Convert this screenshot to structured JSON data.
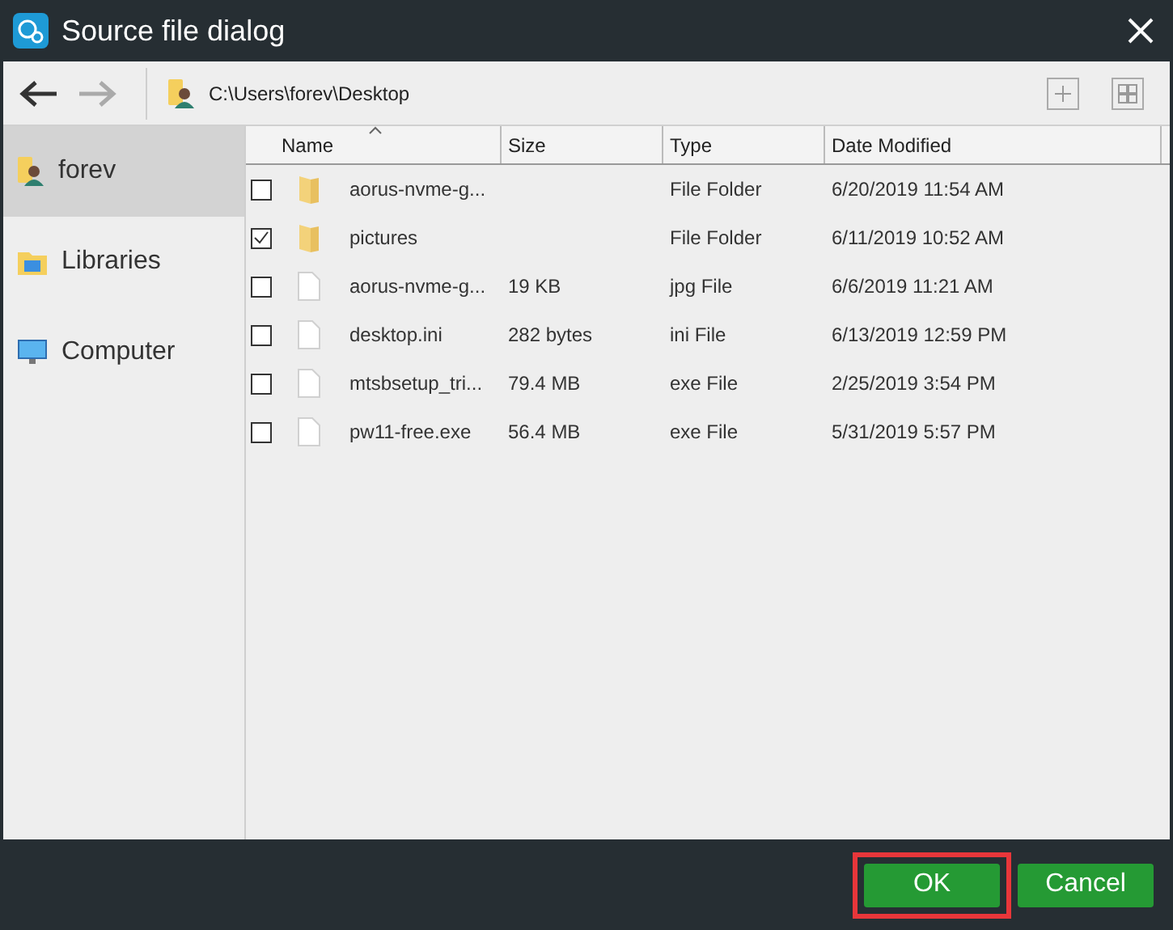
{
  "window": {
    "title": "Source file dialog"
  },
  "toolbar": {
    "path": "C:\\Users\\forev\\Desktop"
  },
  "sidebar": {
    "items": [
      {
        "label": "forev",
        "kind": "user",
        "selected": true
      },
      {
        "label": "Libraries",
        "kind": "library",
        "selected": false
      },
      {
        "label": "Computer",
        "kind": "computer",
        "selected": false
      }
    ]
  },
  "table": {
    "columns": [
      "Name",
      "Size",
      "Type",
      "Date Modified"
    ],
    "rows": [
      {
        "kind": "folder",
        "checked": false,
        "cells": [
          "aorus-nvme-g...",
          "",
          "File Folder",
          "6/20/2019 11:54 AM"
        ]
      },
      {
        "kind": "folder",
        "checked": true,
        "cells": [
          "pictures",
          "",
          "File Folder",
          "6/11/2019 10:52 AM"
        ]
      },
      {
        "kind": "file",
        "checked": false,
        "cells": [
          "aorus-nvme-g...",
          "19 KB",
          "jpg File",
          "6/6/2019 11:21 AM"
        ]
      },
      {
        "kind": "file",
        "checked": false,
        "cells": [
          "desktop.ini",
          "282 bytes",
          "ini File",
          "6/13/2019 12:59 PM"
        ]
      },
      {
        "kind": "file",
        "checked": false,
        "cells": [
          "mtsbsetup_tri...",
          "79.4 MB",
          "exe File",
          "2/25/2019 3:54 PM"
        ]
      },
      {
        "kind": "file",
        "checked": false,
        "cells": [
          "pw11-free.exe",
          "56.4 MB",
          "exe File",
          "5/31/2019 5:57 PM"
        ]
      }
    ]
  },
  "buttons": [
    {
      "label": "OK",
      "highlighted": true
    },
    {
      "label": "Cancel",
      "highlighted": false
    }
  ]
}
